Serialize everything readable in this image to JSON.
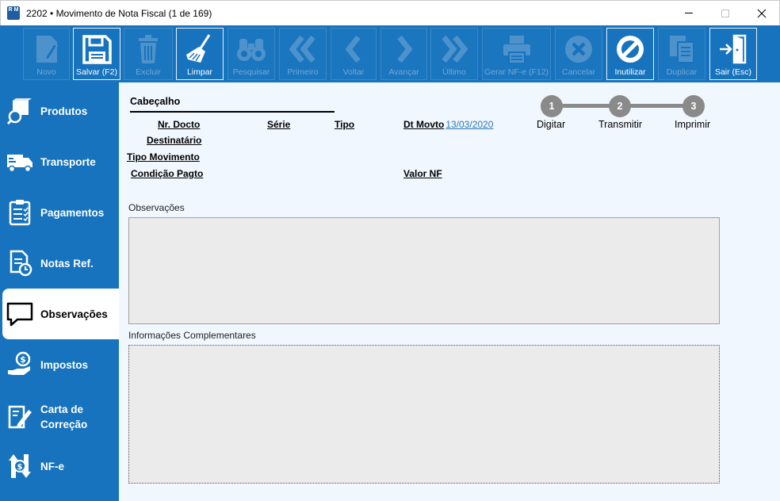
{
  "window": {
    "title": "2202 • Movimento de Nota Fiscal (1 de 169)",
    "app_icon_text": "R M"
  },
  "toolbar": {
    "buttons": [
      {
        "label": "Novo",
        "icon": "new-document-icon",
        "enabled": false
      },
      {
        "label": "Salvar (F2)",
        "icon": "floppy-disk-icon",
        "enabled": true
      },
      {
        "label": "Excluir",
        "icon": "trash-icon",
        "enabled": false
      },
      {
        "label": "Limpar",
        "icon": "broom-icon",
        "enabled": true
      },
      {
        "label": "Pesquisar",
        "icon": "binoculars-icon",
        "enabled": false
      },
      {
        "label": "Primeiro",
        "icon": "double-chevron-left-icon",
        "enabled": false
      },
      {
        "label": "Voltar",
        "icon": "chevron-left-icon",
        "enabled": false
      },
      {
        "label": "Avançar",
        "icon": "chevron-right-icon",
        "enabled": false
      },
      {
        "label": "Último",
        "icon": "double-chevron-right-icon",
        "enabled": false
      },
      {
        "label": "Gerar NF-e (F12)",
        "icon": "printer-icon",
        "enabled": false
      },
      {
        "label": "Cancelar",
        "icon": "cancel-circle-icon",
        "enabled": false
      },
      {
        "label": "Inutilizar",
        "icon": "prohibited-icon",
        "enabled": true
      },
      {
        "label": "Duplicar",
        "icon": "duplicate-icon",
        "enabled": false
      },
      {
        "label": "Sair (Esc)",
        "icon": "exit-door-icon",
        "enabled": true
      }
    ]
  },
  "sidebar": {
    "items": [
      {
        "label": "Produtos",
        "icon": "product-search-icon",
        "active": false
      },
      {
        "label": "Transporte",
        "icon": "truck-icon",
        "active": false
      },
      {
        "label": "Pagamentos",
        "icon": "clipboard-checklist-icon",
        "active": false
      },
      {
        "label": "Notas Ref.",
        "icon": "document-refresh-icon",
        "active": false
      },
      {
        "label": "Observações",
        "icon": "speech-bubble-icon",
        "active": true
      },
      {
        "label": "Impostos",
        "icon": "hand-coin-icon",
        "active": false
      },
      {
        "label": "Carta de\nCorreção",
        "icon": "edit-document-icon",
        "active": false
      },
      {
        "label": "NF-e",
        "icon": "nfe-money-icon",
        "active": false
      }
    ]
  },
  "header": {
    "section_title": "Cabeçalho",
    "fields": {
      "nr_docto": "Nr. Docto",
      "serie": "Série",
      "tipo": "Tipo",
      "dt_movto": "Dt Movto",
      "dt_movto_value": "13/03/2020",
      "destinatario": "Destinatário",
      "tipo_movimento": "Tipo Movimento",
      "condicao_pagto": "Condição Pagto",
      "valor_nf": "Valor NF"
    }
  },
  "steps": [
    {
      "number": "1",
      "label": "Digitar"
    },
    {
      "number": "2",
      "label": "Transmitir"
    },
    {
      "number": "3",
      "label": "Imprimir"
    }
  ],
  "observacoes": {
    "label": "Observações",
    "value": ""
  },
  "info_complementares": {
    "label": "Informações Complementares",
    "value": ""
  }
}
